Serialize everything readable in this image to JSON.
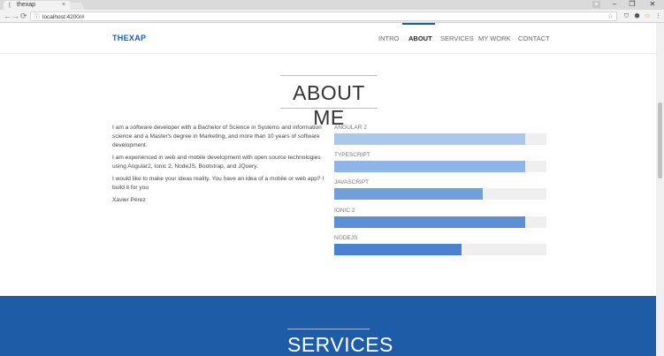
{
  "browser": {
    "tab_title": "thexap",
    "tab_close": "×",
    "favicon": "ᛕ",
    "url": "localhost:4200/#",
    "back": "←",
    "forward": "→",
    "reload": "⟳",
    "info_icon": "ⓘ",
    "star_icon": "☆",
    "minimize": "–",
    "maximize": "❐",
    "close": "✕",
    "menu_icon": "⋮"
  },
  "navbar": {
    "brand": "THEXAP",
    "items": [
      {
        "label": "INTRO",
        "active": false
      },
      {
        "label": "ABOUT",
        "active": true
      },
      {
        "label": "SERVICES",
        "active": false
      },
      {
        "label": "MY WORK",
        "active": false
      },
      {
        "label": "CONTACT",
        "active": false
      }
    ],
    "accent_color": "#1e5ca8"
  },
  "about": {
    "title": "ABOUT ME",
    "paragraphs": [
      "I am a software developer with a Bachelor of Science in Systems and information science and a Master's degree in Marketing, and more than 10 years of software development.",
      "I am experienced in web and mobile development with open source technologies using Angular2, Ionic 2, NodeJS, Bootstrap, and JQuery.",
      "I would like to make your ideas reality. You have an idea of a mobile or web app? I build it for you",
      "Xavier Pérez"
    ],
    "skills": [
      {
        "label": "ANGULAR 2",
        "percent": 90,
        "color": "#a9c8ec"
      },
      {
        "label": "TYPESCRIPT",
        "percent": 90,
        "color": "#8db6e6"
      },
      {
        "label": "JAVASCRIPT",
        "percent": 70,
        "color": "#6f9fdc"
      },
      {
        "label": "IONIC 2",
        "percent": 90,
        "color": "#5b90d6"
      },
      {
        "label": "NODEJS",
        "percent": 60,
        "color": "#4a82cf"
      }
    ]
  },
  "services": {
    "title": "SERVICES",
    "background": "#1e5ca8"
  }
}
